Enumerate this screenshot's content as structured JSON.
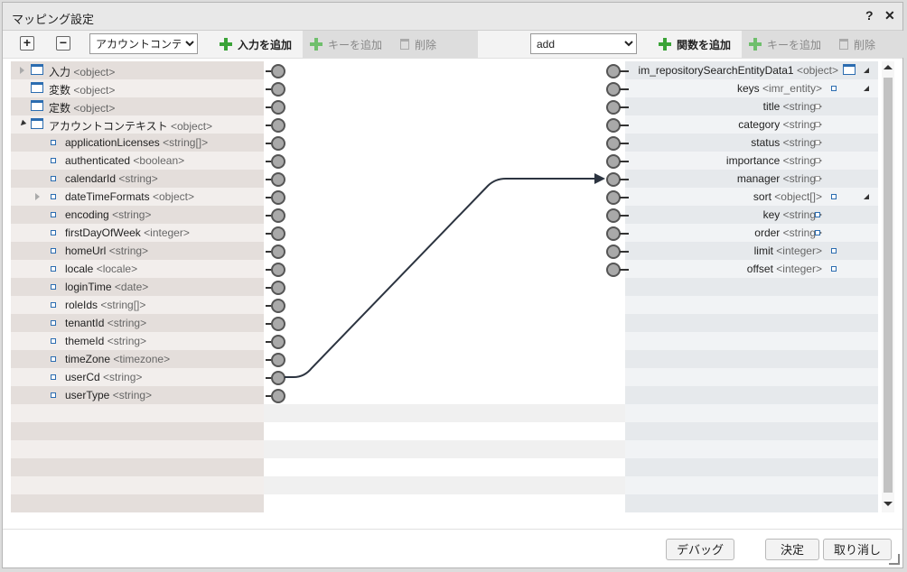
{
  "dialog": {
    "title": "マッピング設定",
    "help_label": "?",
    "close_label": "✕"
  },
  "toolbar_left": {
    "context_select": "アカウントコンテ",
    "add_input": "入力を追加",
    "add_key": "キーを追加",
    "delete": "削除"
  },
  "toolbar_right": {
    "function_select": "add",
    "add_function": "関数を追加",
    "add_key": "キーを追加",
    "delete": "削除"
  },
  "left_tree": [
    {
      "label": "入力",
      "type": "<object>",
      "level": 0,
      "icon": "object",
      "expander": "closed"
    },
    {
      "label": "変数",
      "type": "<object>",
      "level": 0,
      "icon": "object",
      "expander": "none"
    },
    {
      "label": "定数",
      "type": "<object>",
      "level": 0,
      "icon": "object",
      "expander": "none"
    },
    {
      "label": "アカウントコンテキスト",
      "type": "<object>",
      "level": 0,
      "icon": "object",
      "expander": "open"
    },
    {
      "label": "applicationLicenses",
      "type": "<string[]>",
      "level": 1,
      "icon": "leaf",
      "expander": "none"
    },
    {
      "label": "authenticated",
      "type": "<boolean>",
      "level": 1,
      "icon": "leaf",
      "expander": "none"
    },
    {
      "label": "calendarId",
      "type": "<string>",
      "level": 1,
      "icon": "leaf",
      "expander": "none"
    },
    {
      "label": "dateTimeFormats",
      "type": "<object>",
      "level": 1,
      "icon": "leaf",
      "expander": "closed"
    },
    {
      "label": "encoding",
      "type": "<string>",
      "level": 1,
      "icon": "leaf",
      "expander": "none"
    },
    {
      "label": "firstDayOfWeek",
      "type": "<integer>",
      "level": 1,
      "icon": "leaf",
      "expander": "none"
    },
    {
      "label": "homeUrl",
      "type": "<string>",
      "level": 1,
      "icon": "leaf",
      "expander": "none"
    },
    {
      "label": "locale",
      "type": "<locale>",
      "level": 1,
      "icon": "leaf",
      "expander": "none"
    },
    {
      "label": "loginTime",
      "type": "<date>",
      "level": 1,
      "icon": "leaf",
      "expander": "none"
    },
    {
      "label": "roleIds",
      "type": "<string[]>",
      "level": 1,
      "icon": "leaf",
      "expander": "none"
    },
    {
      "label": "tenantId",
      "type": "<string>",
      "level": 1,
      "icon": "leaf",
      "expander": "none"
    },
    {
      "label": "themeId",
      "type": "<string>",
      "level": 1,
      "icon": "leaf",
      "expander": "none"
    },
    {
      "label": "timeZone",
      "type": "<timezone>",
      "level": 1,
      "icon": "leaf",
      "expander": "none"
    },
    {
      "label": "userCd",
      "type": "<string>",
      "level": 1,
      "icon": "leaf",
      "expander": "none"
    },
    {
      "label": "userType",
      "type": "<string>",
      "level": 1,
      "icon": "leaf",
      "expander": "none"
    }
  ],
  "right_tree": [
    {
      "label": "im_repositorySearchEntityData1",
      "type": "<object>",
      "icon": "object",
      "corner": true
    },
    {
      "label": "keys",
      "type": "<imr_entity>",
      "icon": "leaf",
      "corner": true
    },
    {
      "label": "title",
      "type": "<string>",
      "icon": "empty",
      "corner": false
    },
    {
      "label": "category",
      "type": "<string>",
      "icon": "empty",
      "corner": false
    },
    {
      "label": "status",
      "type": "<string>",
      "icon": "empty",
      "corner": false
    },
    {
      "label": "importance",
      "type": "<string>",
      "icon": "empty",
      "corner": false
    },
    {
      "label": "manager",
      "type": "<string>",
      "icon": "empty",
      "corner": false
    },
    {
      "label": "sort",
      "type": "<object[]>",
      "icon": "leaf",
      "corner": true
    },
    {
      "label": "key",
      "type": "<string>",
      "icon": "leaf",
      "corner": false
    },
    {
      "label": "order",
      "type": "<string>",
      "icon": "leaf",
      "corner": false
    },
    {
      "label": "limit",
      "type": "<integer>",
      "icon": "leaf",
      "corner": false
    },
    {
      "label": "offset",
      "type": "<integer>",
      "icon": "leaf",
      "corner": false
    }
  ],
  "mapping": {
    "from": "userCd",
    "to": "manager"
  },
  "footer": {
    "debug": "デバッグ",
    "ok": "決定",
    "cancel": "取り消し"
  }
}
